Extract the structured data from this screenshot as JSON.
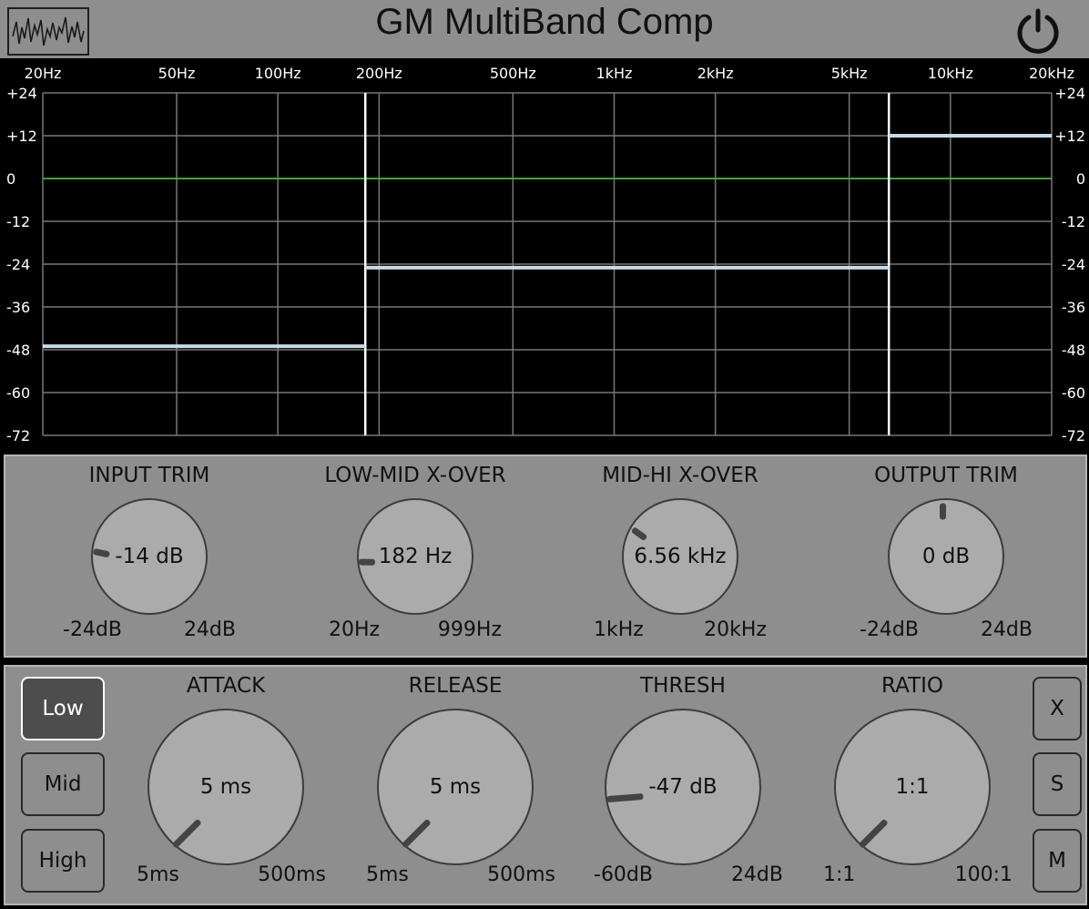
{
  "header": {
    "title": "GM MultiBand Comp",
    "logo_icon": "waveform-icon",
    "power_icon": "power-icon"
  },
  "graph": {
    "freq_labels": [
      "20Hz",
      "50Hz",
      "100Hz",
      "200Hz",
      "500Hz",
      "1kHz",
      "2kHz",
      "5kHz",
      "10kHz",
      "20kHz"
    ],
    "freq_values": [
      20,
      50,
      100,
      200,
      500,
      1000,
      2000,
      5000,
      10000,
      20000
    ],
    "db_labels": [
      "+24",
      "+12",
      "0",
      "-12",
      "-24",
      "-36",
      "-48",
      "-60",
      "-72"
    ],
    "db_values": [
      24,
      12,
      0,
      -12,
      -24,
      -36,
      -48,
      -60,
      -72
    ],
    "crossover_hz": [
      182,
      6560
    ],
    "bands": [
      {
        "name": "Low",
        "from_hz": 20,
        "to_hz": 182,
        "gain_db": -47
      },
      {
        "name": "Mid",
        "from_hz": 182,
        "to_hz": 6560,
        "gain_db": -25
      },
      {
        "name": "High",
        "from_hz": 6560,
        "to_hz": 20000,
        "gain_db": 12
      }
    ],
    "colors": {
      "zero_line": "#3fa33a",
      "band_line": "#c7dbe8",
      "grid": "#777777",
      "crossover": "#ffffff"
    }
  },
  "top_knobs": [
    {
      "title": "INPUT TRIM",
      "value": "-14 dB",
      "min": "-24dB",
      "max": "24dB",
      "fraction": 0.21
    },
    {
      "title": "LOW-MID X-OVER",
      "value": "182 Hz",
      "min": "20Hz",
      "max": "999Hz",
      "fraction": 0.17
    },
    {
      "title": "MID-HI X-OVER",
      "value": "6.56 kHz",
      "min": "1kHz",
      "max": "20kHz",
      "fraction": 0.3
    },
    {
      "title": "OUTPUT TRIM",
      "value": "0 dB",
      "min": "-24dB",
      "max": "24dB",
      "fraction": 0.5
    }
  ],
  "bottom_knobs": [
    {
      "title": "ATTACK",
      "value": "5 ms",
      "min": "5ms",
      "max": "500ms",
      "fraction": 0.0
    },
    {
      "title": "RELEASE",
      "value": "5 ms",
      "min": "5ms",
      "max": "500ms",
      "fraction": 0.0
    },
    {
      "title": "THRESH",
      "value": "-47 dB",
      "min": "-60dB",
      "max": "24dB",
      "fraction": 0.15
    },
    {
      "title": "RATIO",
      "value": "1:1",
      "min": "1:1",
      "max": "100:1",
      "fraction": 0.0
    }
  ],
  "band_buttons": [
    {
      "label": "Low",
      "active": true
    },
    {
      "label": "Mid",
      "active": false
    },
    {
      "label": "High",
      "active": false
    }
  ],
  "side_buttons": [
    {
      "label": "X"
    },
    {
      "label": "S"
    },
    {
      "label": "M"
    }
  ]
}
